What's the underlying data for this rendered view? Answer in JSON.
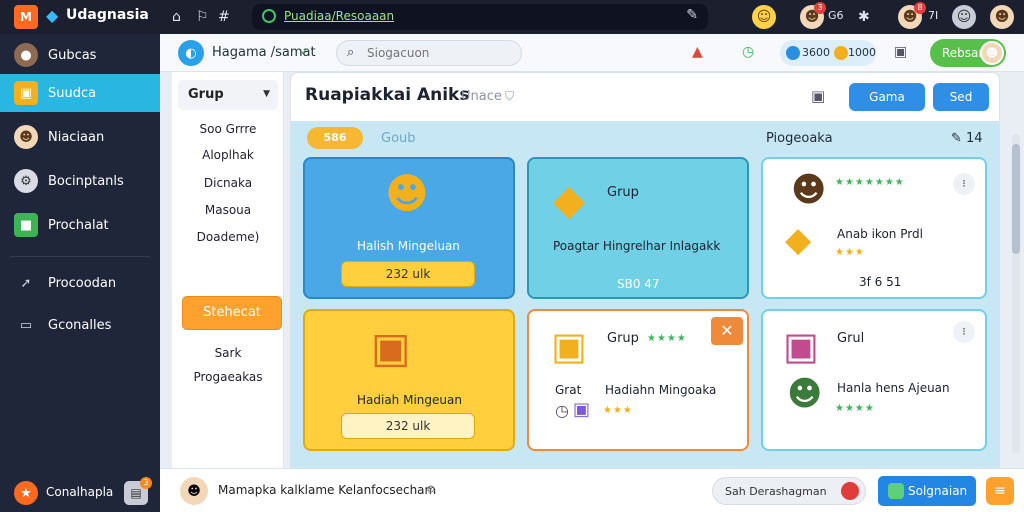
{
  "topbar": {
    "logo_text": "M",
    "app_title": "Udagnasia",
    "url_text": "Puadiaa/Resoaaan",
    "right_text_1": "G6",
    "right_text_2": "7I",
    "badge_1": "3",
    "badge_2": "8"
  },
  "sidebar": {
    "items": [
      {
        "label": "Gubcas",
        "icon": "user-circle-icon"
      },
      {
        "label": "Suudca",
        "icon": "treasure-chest-icon"
      },
      {
        "label": "Niaciaan",
        "icon": "avatar-icon"
      },
      {
        "label": "Bocinptanls",
        "icon": "settings-icon"
      },
      {
        "label": "Prochalat",
        "icon": "cube-icon"
      },
      {
        "label": "Procoodan",
        "icon": "arrow-icon"
      },
      {
        "label": "Gconalles",
        "icon": "monitor-icon"
      }
    ],
    "footer_label": "Conalhapla",
    "footer_badge": "3"
  },
  "header": {
    "user_name": "Hagama /samat",
    "search_placeholder": "Siogacuon",
    "coins_1": "3600",
    "coins_2": "1000",
    "action_button": "Rebsan"
  },
  "categories": {
    "dropdown_label": "Grup",
    "items": [
      "Soo Grrre",
      "Aloplhak",
      "Dicnaka",
      "Masoua",
      "Doademe)"
    ],
    "button_label": "Stehecat",
    "footer_1": "Sark",
    "footer_2": "Progaeakas"
  },
  "content": {
    "title": "Ruapiakkai Aniks",
    "subtitle": "Unace",
    "btn_1": "Gama",
    "btn_2": "Sed",
    "banner_coin": "586",
    "banner_label": "Goub",
    "banner_right_label": "Piogeoaka",
    "banner_right_count": "14"
  },
  "cards": [
    {
      "title": "Halish Mingeluan",
      "value": "232 ulk"
    },
    {
      "title": "Grup",
      "subtitle": "Poagtar Hingrelhar Inlagakk",
      "value": "SB0 47"
    },
    {
      "name": "Anab ikon Prdl",
      "value": "3f 6 51"
    },
    {
      "title": "Hadiah Mingeuan",
      "value": "232 ulk"
    },
    {
      "title": "Grup",
      "label": "Grat",
      "name": "Hadiahn Mingoaka"
    },
    {
      "title": "Grul",
      "name": "Hanla hens Ajeuan"
    }
  ],
  "bottombar": {
    "message": "Mamapka kalklame Kelanfocsecham",
    "input_text": "Sah Derashagman",
    "button_label": "Solgnaian"
  }
}
